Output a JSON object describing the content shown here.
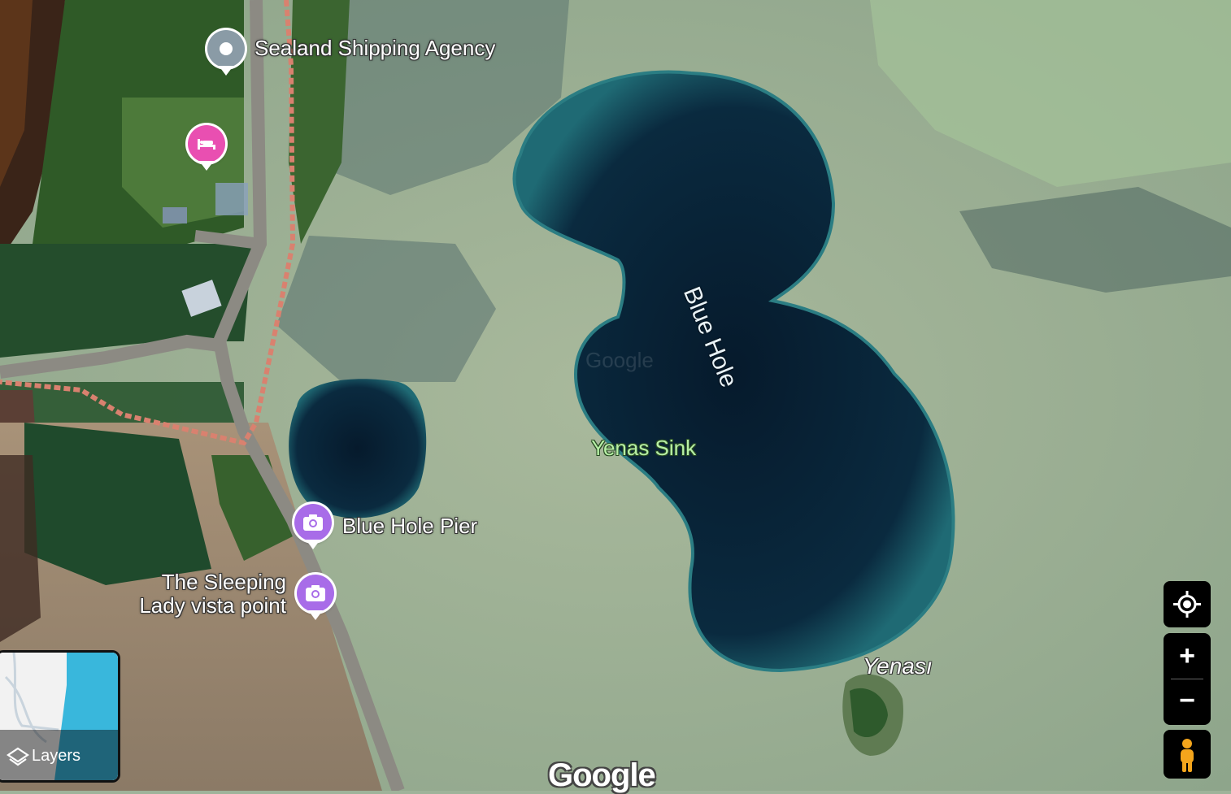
{
  "map": {
    "type": "satellite",
    "places": [
      {
        "name": "Sealand Shipping Agency",
        "kind": "place"
      },
      {
        "name": "Blue Hole Pier",
        "kind": "photo"
      },
      {
        "name": "The Sleeping",
        "line2": "Lady vista point",
        "kind": "photo"
      },
      {
        "name": "Yenas Sink",
        "kind": "natural-feature"
      },
      {
        "name": "Blue Hole",
        "kind": "water"
      },
      {
        "name": "Yenası",
        "kind": "area"
      }
    ],
    "hotel_pin": {
      "icon": "bed-icon"
    },
    "watermark": "Google",
    "faint_watermark": "Google"
  },
  "controls": {
    "layers_label": "Layers",
    "my_location": "my-location-icon",
    "zoom_in": "+",
    "zoom_out": "−",
    "pegman": "pegman-icon"
  },
  "colors": {
    "place_pin": "#8a9ba6",
    "hotel_pin": "#e94fb1",
    "photo_pin": "#a86ce8",
    "feature_text": "#b7f0a6"
  }
}
